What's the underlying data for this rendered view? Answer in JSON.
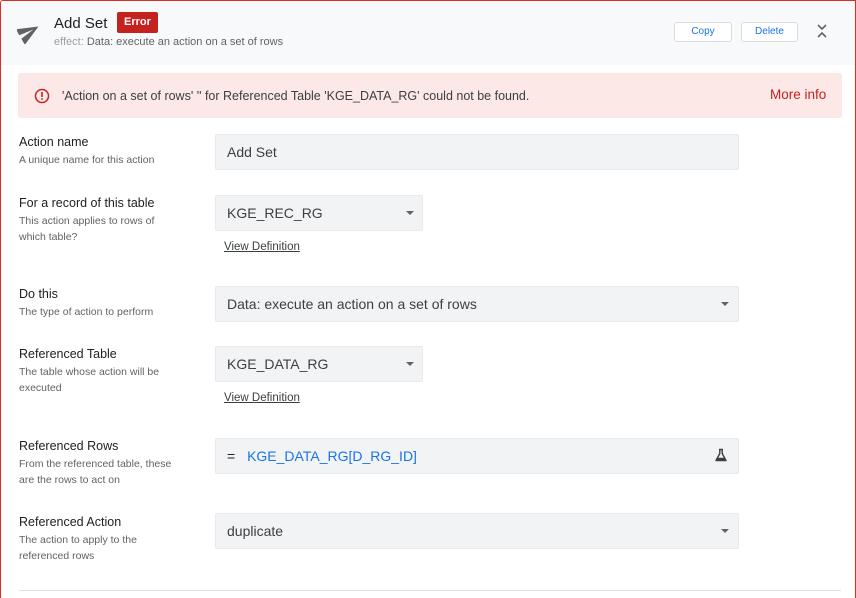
{
  "header": {
    "title": "Add Set",
    "badge": "Error",
    "subtitle_prefix": "effect:",
    "subtitle": "Data: execute an action on a set of rows",
    "copy_label": "Copy",
    "delete_label": "Delete",
    "icon": "paper-plane-icon"
  },
  "alert": {
    "message": "'Action on a set of rows' '' for Referenced Table 'KGE_DATA_RG' could not be found.",
    "link": "More info",
    "icon": "error-circle-icon"
  },
  "fields": {
    "action_name": {
      "label": "Action name",
      "hint": "A unique name for this action",
      "value": "Add Set"
    },
    "table": {
      "label": "For a record of this table",
      "hint_line1": "This action applies to rows of",
      "hint_line2": "which table?",
      "value": "KGE_REC_RG",
      "link": "View Definition"
    },
    "do_this": {
      "label": "Do this",
      "hint": "The type of action to perform",
      "value": "Data: execute an action on a set of rows"
    },
    "referenced_table": {
      "label": "Referenced Table",
      "hint_line1": "The table whose action will be",
      "hint_line2": "executed",
      "value": "KGE_DATA_RG",
      "link": "View Definition"
    },
    "referenced_rows": {
      "label": "Referenced Rows",
      "hint_line1": "From the referenced table, these",
      "hint_line2": "are the rows to act on",
      "eq": "=",
      "value": "KGE_DATA_RG[D_RG_ID]"
    },
    "referenced_action": {
      "label": "Referenced Action",
      "hint_line1": "The action to apply to the",
      "hint_line2": "referenced rows",
      "value": "duplicate"
    }
  },
  "colors": {
    "error": "#c5221f",
    "accent": "#1a73e8",
    "alert_bg": "#fce8e6",
    "field_bg": "#f1f3f4"
  }
}
